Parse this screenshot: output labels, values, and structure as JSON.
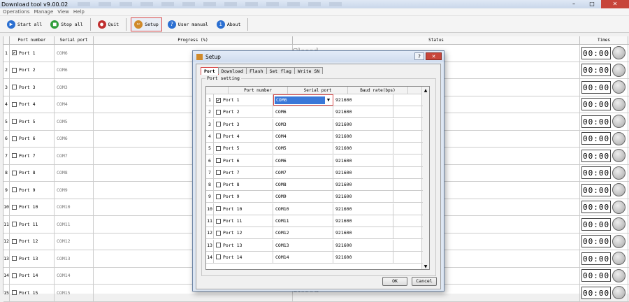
{
  "window": {
    "title": "Download tool v9.00.02"
  },
  "menu": [
    "Operations",
    "Manage",
    "View",
    "Help"
  ],
  "toolbar": [
    {
      "label": "Start all",
      "icon": "play-icon",
      "color": "#2b6fd1"
    },
    {
      "label": "Stop all",
      "icon": "stop-icon",
      "color": "#2f9d3a"
    },
    {
      "label": "Quit",
      "icon": "quit-icon",
      "color": "#c03030"
    },
    {
      "label": "Setup",
      "icon": "setup-icon",
      "color": "#d08a2a"
    },
    {
      "label": "User manual",
      "icon": "help-icon",
      "color": "#2b6fd1"
    },
    {
      "label": "About",
      "icon": "about-icon",
      "color": "#2b6fd1"
    }
  ],
  "grid": {
    "headers": [
      "Port number",
      "Serial port",
      "Progress (%)",
      "Status",
      "Times"
    ],
    "rows": [
      {
        "num": "1",
        "port": "Port 1",
        "checked": true,
        "serial": "COM6",
        "time": "00:00"
      },
      {
        "num": "2",
        "port": "Port 2",
        "checked": false,
        "serial": "COM6",
        "time": "00:00"
      },
      {
        "num": "3",
        "port": "Port 3",
        "checked": false,
        "serial": "COM3",
        "time": "00:00"
      },
      {
        "num": "4",
        "port": "Port 4",
        "checked": false,
        "serial": "COM4",
        "time": "00:00"
      },
      {
        "num": "5",
        "port": "Port 5",
        "checked": false,
        "serial": "COM5",
        "time": "00:00"
      },
      {
        "num": "6",
        "port": "Port 6",
        "checked": false,
        "serial": "COM6",
        "time": "00:00"
      },
      {
        "num": "7",
        "port": "Port 7",
        "checked": false,
        "serial": "COM7",
        "time": "00:00"
      },
      {
        "num": "8",
        "port": "Port 8",
        "checked": false,
        "serial": "COM8",
        "time": "00:00"
      },
      {
        "num": "9",
        "port": "Port 9",
        "checked": false,
        "serial": "COM9",
        "time": "00:00"
      },
      {
        "num": "10",
        "port": "Port 10",
        "checked": false,
        "serial": "COM10",
        "time": "00:00"
      },
      {
        "num": "11",
        "port": "Port 11",
        "checked": false,
        "serial": "COM11",
        "time": "00:00"
      },
      {
        "num": "12",
        "port": "Port 12",
        "checked": false,
        "serial": "COM12",
        "time": "00:00"
      },
      {
        "num": "13",
        "port": "Port 13",
        "checked": false,
        "serial": "COM13",
        "time": "00:00"
      },
      {
        "num": "14",
        "port": "Port 14",
        "checked": false,
        "serial": "COM14",
        "time": "00:00"
      },
      {
        "num": "15",
        "port": "Port 15",
        "checked": false,
        "serial": "COM15",
        "time": "00:00"
      }
    ],
    "status_text": "Closed"
  },
  "dialog": {
    "title": "Setup",
    "help": "?",
    "tabs": [
      "Port",
      "Download",
      "Flash",
      "Set flag",
      "Write SN"
    ],
    "group_label": "Port setting",
    "headers": [
      "Port number",
      "Serial port",
      "Baud rate(bps)"
    ],
    "rows": [
      {
        "num": "1",
        "port": "Port 1",
        "checked": true,
        "serial": "COM6",
        "baud": "921600"
      },
      {
        "num": "2",
        "port": "Port 2",
        "checked": false,
        "serial": "COM6",
        "baud": "921600"
      },
      {
        "num": "3",
        "port": "Port 3",
        "checked": false,
        "serial": "COM3",
        "baud": "921600"
      },
      {
        "num": "4",
        "port": "Port 4",
        "checked": false,
        "serial": "COM4",
        "baud": "921600"
      },
      {
        "num": "5",
        "port": "Port 5",
        "checked": false,
        "serial": "COM5",
        "baud": "921600"
      },
      {
        "num": "6",
        "port": "Port 6",
        "checked": false,
        "serial": "COM6",
        "baud": "921600"
      },
      {
        "num": "7",
        "port": "Port 7",
        "checked": false,
        "serial": "COM7",
        "baud": "921600"
      },
      {
        "num": "8",
        "port": "Port 8",
        "checked": false,
        "serial": "COM8",
        "baud": "921600"
      },
      {
        "num": "9",
        "port": "Port 9",
        "checked": false,
        "serial": "COM9",
        "baud": "921600"
      },
      {
        "num": "10",
        "port": "Port 10",
        "checked": false,
        "serial": "COM10",
        "baud": "921600"
      },
      {
        "num": "11",
        "port": "Port 11",
        "checked": false,
        "serial": "COM11",
        "baud": "921600"
      },
      {
        "num": "12",
        "port": "Port 12",
        "checked": false,
        "serial": "COM12",
        "baud": "921600"
      },
      {
        "num": "13",
        "port": "Port 13",
        "checked": false,
        "serial": "COM13",
        "baud": "921600"
      },
      {
        "num": "14",
        "port": "Port 14",
        "checked": false,
        "serial": "COM14",
        "baud": "921600"
      }
    ],
    "ok_label": "OK",
    "cancel_label": "Cancel"
  },
  "colors": {
    "accent": "#3a78d8",
    "highlight_border": "#d84a4a"
  }
}
